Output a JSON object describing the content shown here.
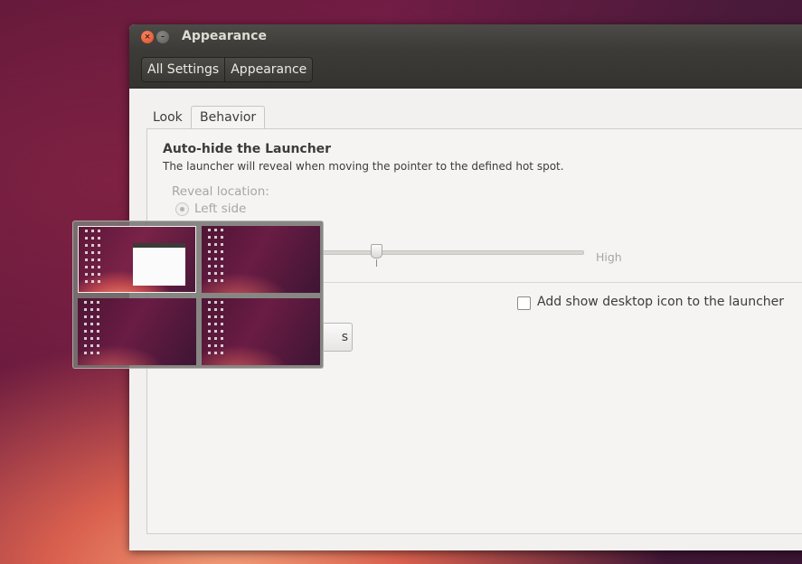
{
  "window": {
    "title": "Appearance",
    "close_glyph": "×",
    "minimize_glyph": "–"
  },
  "toolbar": {
    "breadcrumbs": [
      "All Settings",
      "Appearance"
    ]
  },
  "tabs": [
    {
      "label": "Look",
      "active": false
    },
    {
      "label": "Behavior",
      "active": true
    }
  ],
  "behavior": {
    "section_title": "Auto-hide the Launcher",
    "section_subtitle": "The launcher will reveal when moving the pointer to the defined hot spot.",
    "reveal_location_label": "Reveal location:",
    "left_side_label": "Left side",
    "sensitivity": {
      "high_label": "High",
      "value_fraction": 0.27
    },
    "show_desktop_checkbox": {
      "label": "Add show desktop icon to the launcher",
      "checked": false
    },
    "restore_button_partial": "s"
  },
  "workspace_switcher": {
    "workspaces": [
      {
        "index": 1,
        "active": true,
        "has_window": true
      },
      {
        "index": 2,
        "active": false,
        "has_window": false
      },
      {
        "index": 3,
        "active": false,
        "has_window": false
      },
      {
        "index": 4,
        "active": false,
        "has_window": false
      }
    ]
  },
  "colors": {
    "accent": "#df4a1e",
    "titlebar": "#3c3b37",
    "window_bg": "#f2f1f0"
  }
}
